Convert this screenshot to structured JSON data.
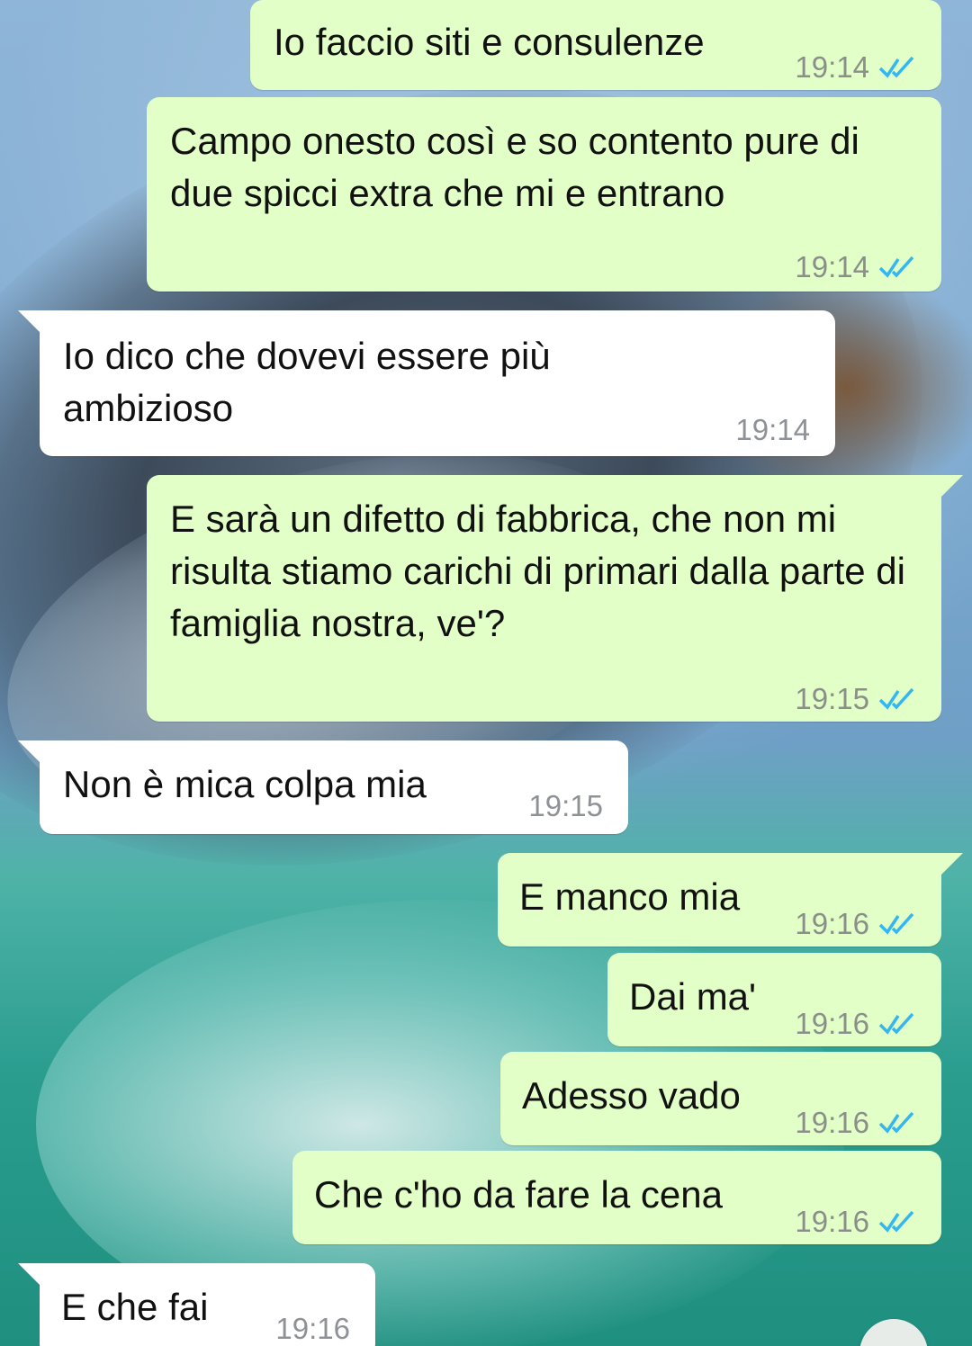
{
  "colors": {
    "outgoing_bubble": "#e2ffc7",
    "incoming_bubble": "#ffffff",
    "read_ticks": "#34b7f1",
    "timestamp": "#8a8f8a"
  },
  "messages": [
    {
      "direction": "out",
      "text": "Io faccio siti e consulenze",
      "time": "19:14",
      "status": "read"
    },
    {
      "direction": "out",
      "text": "Campo onesto così e so contento pure di due spicci extra che mi e entrano",
      "time": "19:14",
      "status": "read"
    },
    {
      "direction": "in",
      "text": "Io dico che dovevi essere più ambizioso",
      "time": "19:14"
    },
    {
      "direction": "out",
      "text": "E sarà un difetto di fabbrica, che non mi risulta stiamo carichi di primari dalla parte di famiglia nostra, ve'?",
      "time": "19:15",
      "status": "read"
    },
    {
      "direction": "in",
      "text": "Non è mica colpa mia",
      "time": "19:15"
    },
    {
      "direction": "out",
      "text": "E manco mia",
      "time": "19:16",
      "status": "read"
    },
    {
      "direction": "out",
      "text": "Dai ma'",
      "time": "19:16",
      "status": "read"
    },
    {
      "direction": "out",
      "text": "Adesso vado",
      "time": "19:16",
      "status": "read"
    },
    {
      "direction": "out",
      "text": "Che c'ho da fare la cena",
      "time": "19:16",
      "status": "read"
    },
    {
      "direction": "in",
      "text": "E che fai",
      "time": "19:16"
    }
  ],
  "icons": {
    "read_status": "double-check-icon",
    "scroll_down": "scroll-down-icon"
  }
}
